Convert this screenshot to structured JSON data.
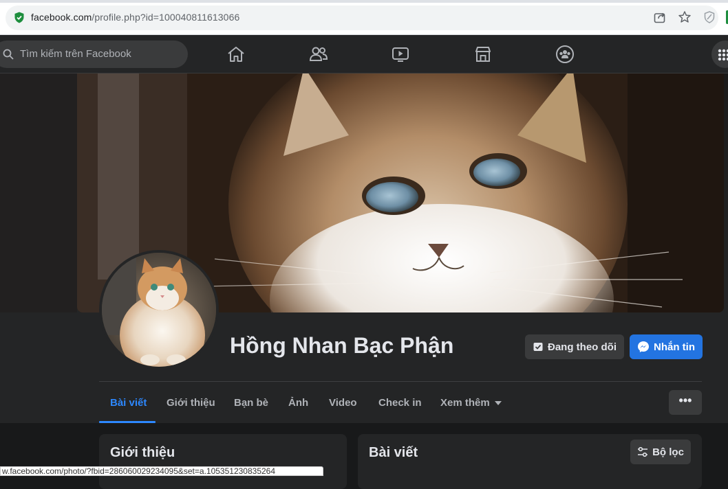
{
  "browser": {
    "url_host": "facebook.com",
    "url_path": "/profile.php?id=100040811613066"
  },
  "nav": {
    "search_placeholder": "Tìm kiếm trên Facebook",
    "icons": [
      "home-icon",
      "friends-icon",
      "watch-icon",
      "marketplace-icon",
      "groups-icon",
      "menu-grid-icon"
    ]
  },
  "profile": {
    "name": "Hồng Nhan Bạc Phận",
    "follow_label": "Đang theo dõi",
    "message_label": "Nhắn tin"
  },
  "tabs": [
    {
      "label": "Bài viết",
      "active": true
    },
    {
      "label": "Giới thiệu"
    },
    {
      "label": "Bạn bè"
    },
    {
      "label": "Ảnh"
    },
    {
      "label": "Video"
    },
    {
      "label": "Check in"
    },
    {
      "label": "Xem thêm"
    }
  ],
  "more_label": "•••",
  "cards": {
    "intro_title": "Giới thiệu",
    "posts_title": "Bài viết",
    "filter_label": "Bộ lọc"
  },
  "status_url": "w.facebook.com/photo/?fbid=286060029234095&set=a.105351230835264",
  "colors": {
    "accent": "#2d88ff",
    "message_button": "#2374e1",
    "background": "#18191a",
    "surface": "#242526"
  }
}
